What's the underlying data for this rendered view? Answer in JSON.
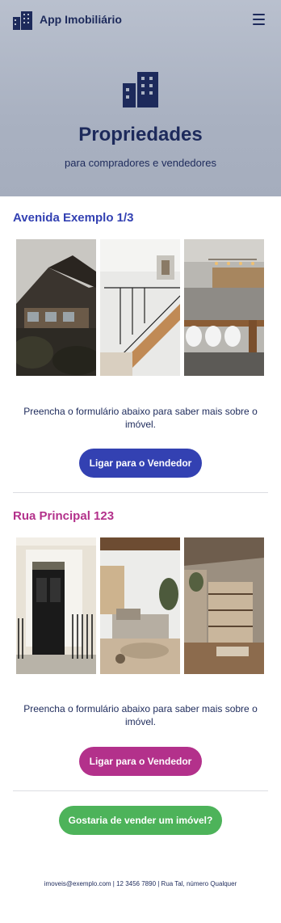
{
  "app": {
    "title": "App Imobiliário",
    "logo_icon": "buildings-icon",
    "menu_icon": "hamburger-menu-icon"
  },
  "hero": {
    "title": "Propriedades",
    "subtitle": "para compradores e vendedores",
    "icon": "buildings-icon"
  },
  "properties": [
    {
      "title": "Avenida Exemplo 1/3",
      "accent": "#3341b2",
      "photos": [
        "house-exterior-photo",
        "staircase-interior-photo",
        "kitchen-dining-photo"
      ],
      "description": "Preencha o formulário abaixo para saber mais sobre o imóvel.",
      "button_label": "Ligar para o Vendedor"
    },
    {
      "title": "Rua Principal 123",
      "accent": "#b3318b",
      "photos": [
        "black-front-door-photo",
        "bedroom-interior-photo",
        "living-room-shelves-photo"
      ],
      "description": "Preencha o formulário abaixo para saber mais sobre o imóvel.",
      "button_label": "Ligar para o Vendedor"
    }
  ],
  "sell_button": {
    "label": "Gostaria de vender um imóvel?",
    "color": "#4db35a"
  },
  "footer": {
    "text": "imoveis@exemplo.com | 12 3456 7890 | Rua Tal, número Qualquer"
  },
  "colors": {
    "navy": "#1d2a5b",
    "header_bg": "#b1b8c7"
  }
}
